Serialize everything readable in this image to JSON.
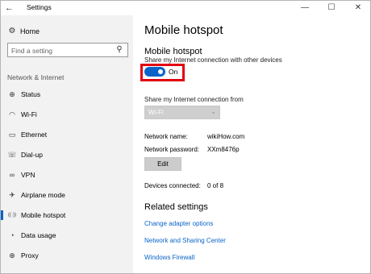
{
  "window": {
    "title": "Settings",
    "back_icon": "back-arrow-icon",
    "controls": {
      "minimize": "—",
      "maximize": "☐",
      "close": "✕"
    }
  },
  "sidebar": {
    "home_label": "Home",
    "search_placeholder": "Find a setting",
    "section_label": "Network & Internet",
    "items": [
      {
        "label": "Status",
        "icon": "globe-icon",
        "glyph": "⊕",
        "active": false
      },
      {
        "label": "Wi-Fi",
        "icon": "wifi-icon",
        "glyph": "◠",
        "active": false
      },
      {
        "label": "Ethernet",
        "icon": "ethernet-icon",
        "glyph": "▭",
        "active": false
      },
      {
        "label": "Dial-up",
        "icon": "dialup-icon",
        "glyph": "☏",
        "active": false
      },
      {
        "label": "VPN",
        "icon": "vpn-icon",
        "glyph": "∞",
        "active": false
      },
      {
        "label": "Airplane mode",
        "icon": "airplane-icon",
        "glyph": "✈",
        "active": false
      },
      {
        "label": "Mobile hotspot",
        "icon": "hotspot-icon",
        "glyph": "((·))",
        "active": true
      },
      {
        "label": "Data usage",
        "icon": "data-usage-icon",
        "glyph": "◔",
        "active": false
      },
      {
        "label": "Proxy",
        "icon": "proxy-icon",
        "glyph": "⊕",
        "active": false
      }
    ]
  },
  "main": {
    "page_title": "Mobile hotspot",
    "section_title": "Mobile hotspot",
    "share_description": "Share my Internet connection with other devices",
    "toggle_state": "On",
    "share_from_label": "Share my Internet connection from",
    "share_from_value": "Wi-Fi",
    "network_name_label": "Network name:",
    "network_name_value": "wikiHow.com",
    "network_password_label": "Network password:",
    "network_password_value": "XXm8476p",
    "edit_label": "Edit",
    "devices_connected_label": "Devices connected:",
    "devices_connected_value": "0 of 8",
    "related_title": "Related settings",
    "links": [
      "Change adapter options",
      "Network and Sharing Center",
      "Windows Firewall"
    ]
  },
  "colors": {
    "accent": "#0a64c8",
    "highlight_border": "#e3000f",
    "sidebar_bg": "#f2f2f2"
  }
}
